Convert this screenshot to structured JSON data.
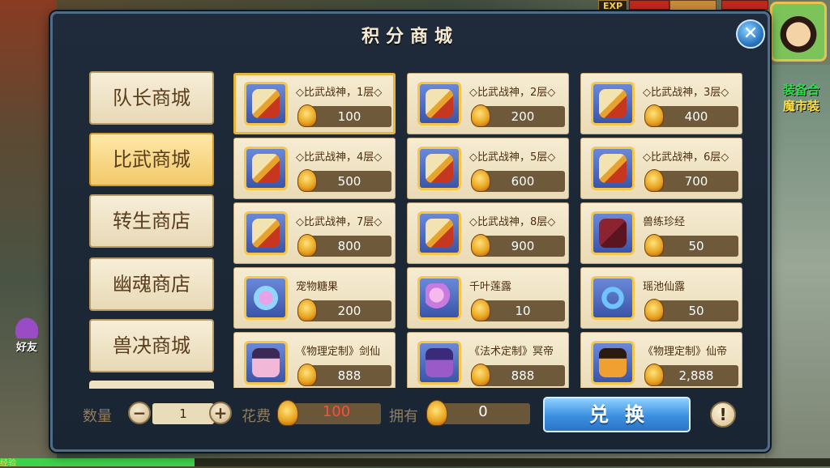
{
  "hud": {
    "exp_badge": "EXP",
    "side_text_1": "装备合",
    "side_text_2": "魔市装",
    "friend_label": "好友",
    "bottom_exp_label": "经验"
  },
  "dialog": {
    "title": "积分商城",
    "close_label": "✕"
  },
  "tabs": [
    {
      "label": "队长商城"
    },
    {
      "label": "比武商城"
    },
    {
      "label": "转生商店"
    },
    {
      "label": "幽魂商店"
    },
    {
      "label": "兽决商城"
    }
  ],
  "active_tab_index": 1,
  "items": [
    {
      "name": "◇比武战神，1层◇",
      "price": "100",
      "icon": "scroll-icon"
    },
    {
      "name": "◇比武战神，2层◇",
      "price": "200",
      "icon": "scroll-icon"
    },
    {
      "name": "◇比武战神，3层◇",
      "price": "400",
      "icon": "scroll-icon"
    },
    {
      "name": "◇比武战神，4层◇",
      "price": "500",
      "icon": "scroll-icon"
    },
    {
      "name": "◇比武战神，5层◇",
      "price": "600",
      "icon": "scroll-icon"
    },
    {
      "name": "◇比武战神，6层◇",
      "price": "700",
      "icon": "scroll-icon"
    },
    {
      "name": "◇比武战神，7层◇",
      "price": "800",
      "icon": "scroll-icon"
    },
    {
      "name": "◇比武战神，8层◇",
      "price": "900",
      "icon": "scroll-icon"
    },
    {
      "name": "兽练珍经",
      "price": "50",
      "icon": "book-icon"
    },
    {
      "name": "宠物糖果",
      "price": "200",
      "icon": "candy-icon"
    },
    {
      "name": "千叶莲露",
      "price": "10",
      "icon": "lotus-dew-icon"
    },
    {
      "name": "瑶池仙露",
      "price": "50",
      "icon": "fairy-dew-icon"
    },
    {
      "name": "《物理定制》剑仙",
      "price": "888",
      "icon": "hero-jianxian-icon"
    },
    {
      "name": "《法术定制》冥帝",
      "price": "888",
      "icon": "hero-mingdi-icon"
    },
    {
      "name": "《物理定制》仙帝",
      "price": "2,888",
      "icon": "hero-xiandi-icon"
    }
  ],
  "selected_item_index": 0,
  "purchase": {
    "quantity_label": "数量",
    "quantity": "1",
    "minus_label": "−",
    "plus_label": "+",
    "cost_label": "花费",
    "cost_value": "100",
    "owned_label": "拥有",
    "owned_value": "0",
    "exchange_label": "兑换",
    "info_label": "!"
  },
  "colors": {
    "cost_text": "#ff4d3d",
    "owned_text": "#ffffff",
    "panel_bg": "#1f2b3a"
  }
}
